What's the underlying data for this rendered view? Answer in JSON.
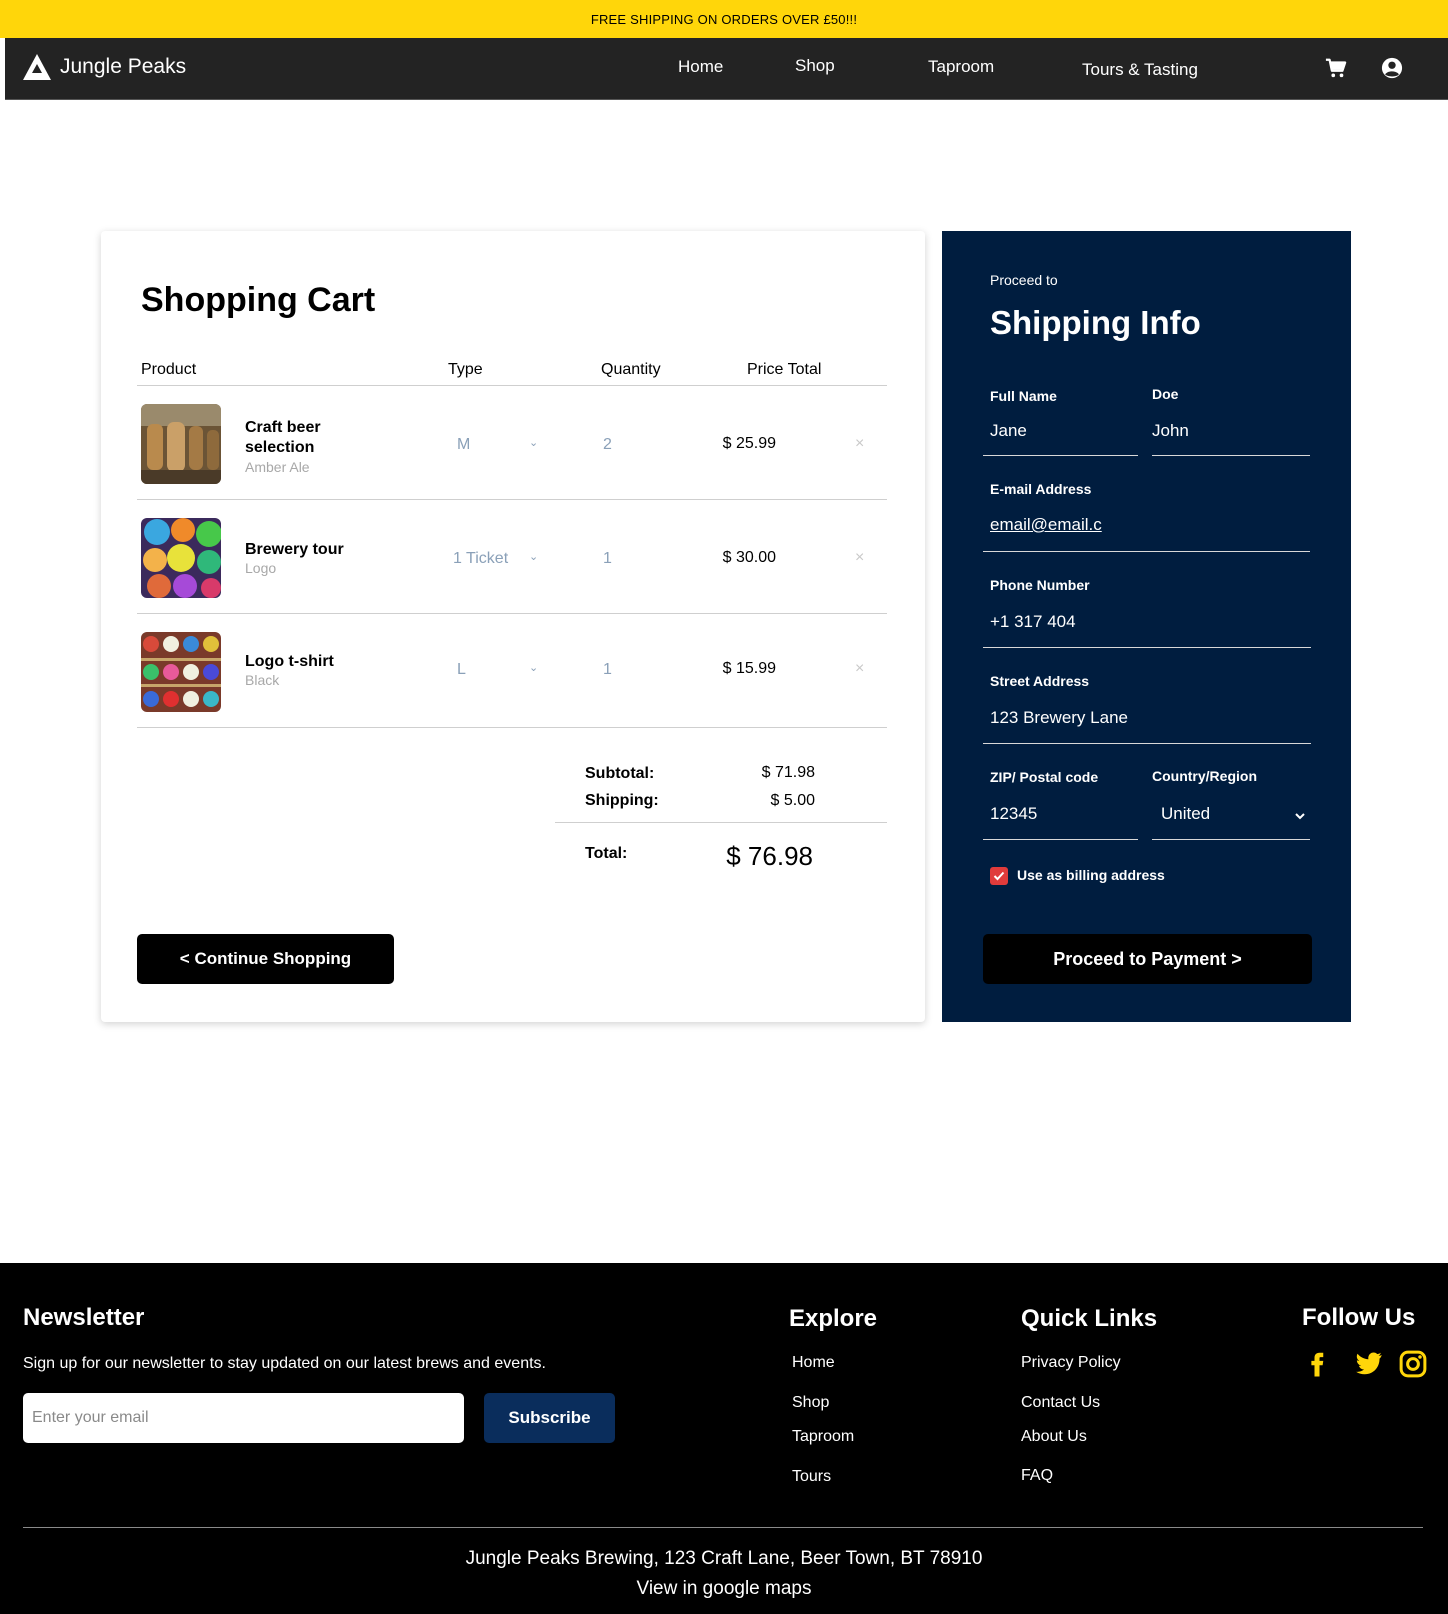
{
  "promo": {
    "text": "FREE SHIPPING ON ORDERS OVER £50!!!"
  },
  "header": {
    "brand": "Jungle Peaks",
    "nav": [
      "Home",
      "Shop",
      "Taproom",
      "Tours & Tasting"
    ],
    "icons": [
      "cart-icon",
      "user-icon"
    ]
  },
  "cart": {
    "title": "Shopping Cart",
    "columns": [
      "Product",
      "Type",
      "Quantity",
      "Price Total"
    ],
    "items": [
      {
        "name": "Craft beer selection",
        "sub": "Amber Ale",
        "type": "M",
        "qty": "2",
        "price": "$ 25.99",
        "remove": "×"
      },
      {
        "name": "Brewery tour",
        "sub": "Logo",
        "type": "1 Ticket",
        "qty": "1",
        "price": "$ 30.00",
        "remove": "×"
      },
      {
        "name": "Logo t-shirt",
        "sub": "Black",
        "type": "L",
        "qty": "1",
        "price": "$ 15.99",
        "remove": "×"
      }
    ],
    "subtotal_label": "Subtotal:",
    "subtotal": "$ 71.98",
    "shipping_label": "Shipping:",
    "shipping": "$ 5.00",
    "total_label": "Total:",
    "total": "$ 76.98",
    "continue_label": "< Continue Shopping"
  },
  "shipping": {
    "pre": "Proceed to",
    "title": "Shipping Info",
    "full_name_label": "Full Name",
    "first_name": "Jane",
    "last_name_label": "Doe",
    "last_name": "John",
    "email_label": "E-mail Address",
    "email": "email@email.c",
    "phone_label": "Phone Number",
    "phone": "+1 317 404",
    "street_label": "Street Address",
    "street": "123 Brewery Lane",
    "zip_label": "ZIP/ Postal code",
    "zip": "12345",
    "country_label": "Country/Region",
    "country": "United",
    "billing_label": "Use as billing address",
    "billing_checked": true,
    "pay_label": "Proceed to Payment >"
  },
  "footer": {
    "newsletter_title": "Newsletter",
    "newsletter_text": "Sign up for our newsletter to stay updated on our latest brews and events.",
    "email_placeholder": "Enter your email",
    "subscribe_label": "Subscribe",
    "explore_title": "Explore",
    "explore_links": [
      "Home",
      "Shop",
      "Taproom",
      "Tours"
    ],
    "quick_title": "Quick Links",
    "quick_links": [
      "Privacy Policy",
      "Contact Us",
      "About Us",
      "FAQ"
    ],
    "follow_title": "Follow Us",
    "social_icons": [
      "facebook-icon",
      "twitter-icon",
      "instagram-icon"
    ],
    "address": "Jungle Peaks Brewing, 123 Craft Lane, Beer Town, BT 78910",
    "maps_link": "View in google maps",
    "accent_color": "#ffd60a"
  }
}
